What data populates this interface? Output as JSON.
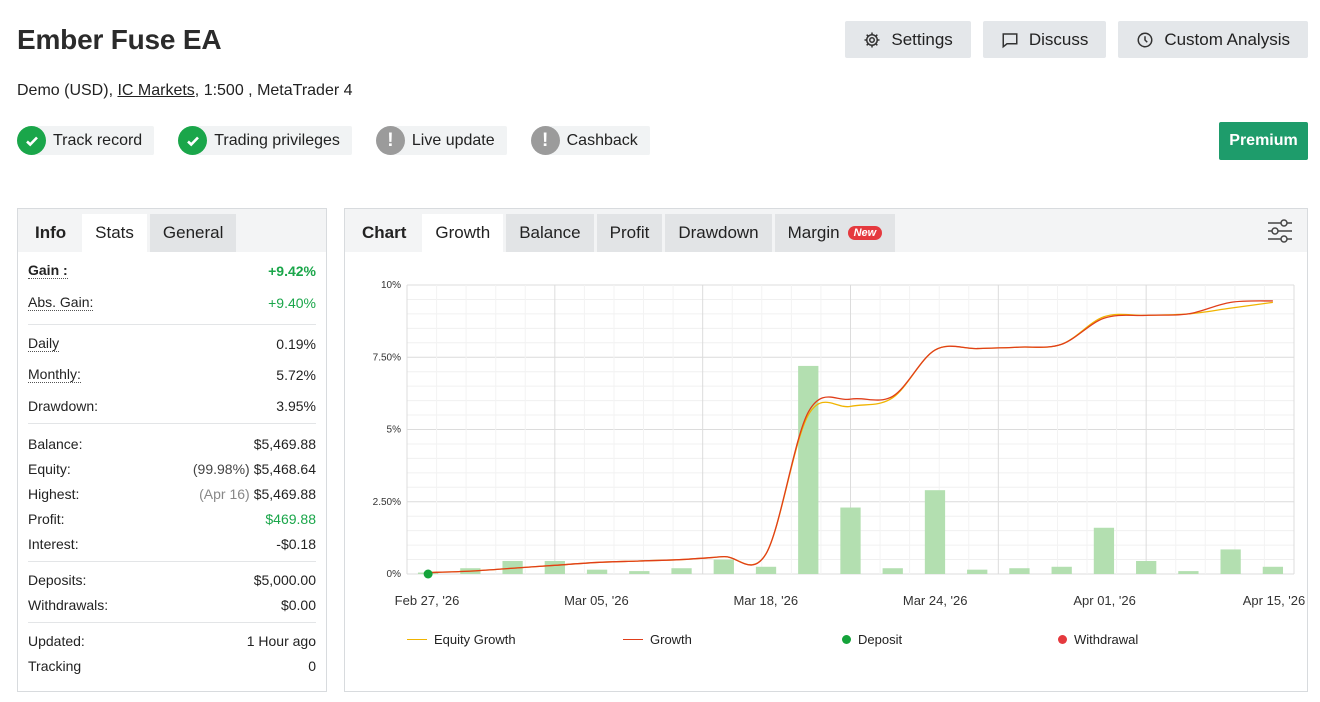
{
  "header": {
    "title": "Ember Fuse EA",
    "settings_label": "Settings",
    "discuss_label": "Discuss",
    "custom_analysis_label": "Custom Analysis"
  },
  "subtitle": {
    "prefix": "Demo (USD), ",
    "broker": "IC Markets",
    "suffix": ", 1:500 , MetaTrader 4"
  },
  "badges": [
    {
      "label": "Track record",
      "status": "verified",
      "icon": "check-icon"
    },
    {
      "label": "Trading privileges",
      "status": "verified",
      "icon": "check-icon"
    },
    {
      "label": "Live update",
      "status": "unverified",
      "icon": "exclamation-icon"
    },
    {
      "label": "Cashback",
      "status": "unverified",
      "icon": "exclamation-icon"
    }
  ],
  "premium_label": "Premium",
  "left_panel": {
    "tabs": [
      "Info",
      "Stats",
      "General"
    ],
    "stats": {
      "gain_label": "Gain :",
      "gain_value": "+9.42%",
      "abs_gain_label": "Abs. Gain:",
      "abs_gain_value": "+9.40%",
      "daily_label": "Daily",
      "daily_value": "0.19%",
      "monthly_label": "Monthly:",
      "monthly_value": "5.72%",
      "drawdown_label": "Drawdown:",
      "drawdown_value": "3.95%",
      "balance_label": "Balance:",
      "balance_value": "$5,469.88",
      "equity_label": "Equity:",
      "equity_note": "(99.98%)",
      "equity_value": "$5,468.64",
      "highest_label": "Highest:",
      "highest_note": "(Apr 16)",
      "highest_value": "$5,469.88",
      "profit_label": "Profit:",
      "profit_value": "$469.88",
      "interest_label": "Interest:",
      "interest_value": "-$0.18",
      "deposits_label": "Deposits:",
      "deposits_value": "$5,000.00",
      "withdrawals_label": "Withdrawals:",
      "withdrawals_value": "$0.00",
      "updated_label": "Updated:",
      "updated_value": "1 Hour ago",
      "tracking_label": "Tracking",
      "tracking_value": "0"
    }
  },
  "chart_panel": {
    "tabs": [
      "Chart",
      "Growth",
      "Balance",
      "Profit",
      "Drawdown",
      "Margin"
    ],
    "new_badge": "New"
  },
  "colors": {
    "equity_growth": "#f0b400",
    "growth": "#e03e1a",
    "bars": "#b3dfb0",
    "deposit": "#14a33a",
    "withdrawal": "#e5393e",
    "premium": "#1e9c6b"
  },
  "chart_data": {
    "type": "line",
    "x_tick_labels": [
      "Feb 27, '26",
      "Mar 05, '26",
      "Mar 18, '26",
      "Mar 24, '26",
      "Apr 01, '26",
      "Apr 15, '26"
    ],
    "y_tick_labels": [
      "0%",
      "2.50%",
      "5%",
      "7.50%",
      "10%"
    ],
    "ylim": [
      0,
      10
    ],
    "grid": true,
    "legend_position": "bottom",
    "legend": [
      "Equity Growth",
      "Growth",
      "Deposit",
      "Withdrawal"
    ],
    "series": [
      {
        "name": "Equity Growth",
        "values": [
          0.05,
          0.1,
          0.2,
          0.3,
          0.4,
          0.45,
          0.5,
          0.6,
          0.7,
          5.5,
          5.8,
          6.1,
          7.75,
          7.8,
          7.85,
          7.95,
          8.9,
          8.95,
          9.0,
          9.2,
          9.4
        ]
      },
      {
        "name": "Growth",
        "values": [
          0.05,
          0.1,
          0.2,
          0.3,
          0.4,
          0.45,
          0.5,
          0.6,
          0.7,
          5.6,
          6.05,
          6.15,
          7.75,
          7.8,
          7.85,
          7.95,
          8.85,
          8.95,
          9.0,
          9.4,
          9.45
        ]
      }
    ],
    "bars": {
      "name": "Profit",
      "values": [
        0.05,
        0.2,
        0.45,
        0.45,
        0.15,
        0.1,
        0.2,
        0.5,
        0.25,
        7.2,
        2.3,
        0.2,
        2.9,
        0.15,
        0.2,
        0.25,
        1.6,
        0.45,
        0.1,
        0.85,
        0.25
      ]
    },
    "deposit_points": [
      {
        "index": 0,
        "value": 0
      }
    ]
  }
}
